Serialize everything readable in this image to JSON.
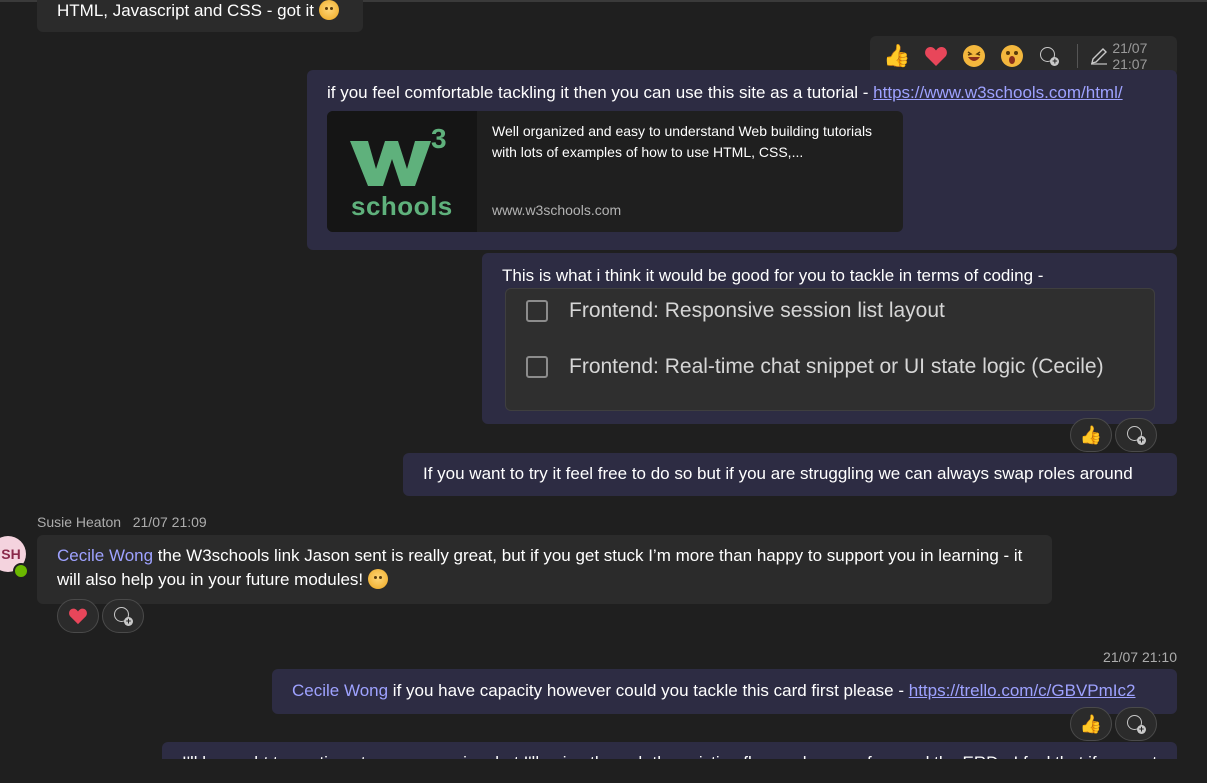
{
  "messages": {
    "m0": {
      "text": "HTML, Javascript and CSS - got it"
    },
    "m1": {
      "text": "if you feel comfortable tackling it then you can use this site as a tutorial - ",
      "link": "https://www.w3schools.com/html/",
      "preview": {
        "logo_text": "schools",
        "logo_sup": "3",
        "description": "Well organized and easy to understand Web building tutorials with lots of examples of how to use HTML, CSS,...",
        "domain": "www.w3schools.com"
      }
    },
    "m2": {
      "text": "This is what i think it would be good for you to tackle in terms of coding -",
      "tasks": [
        "Frontend: Responsive session list layout",
        "Frontend: Real-time chat snippet or UI state logic (Cecile)"
      ]
    },
    "m3": {
      "text": "If you want to try it feel free to do so but if you are struggling we can always swap roles around"
    },
    "m4": {
      "sender": "Susie Heaton",
      "time": "21/07 21:09",
      "avatar_initials": "SH",
      "mention": "Cecile Wong",
      "text": " the W3schools link Jason sent is really great, but if you get stuck I’m more than happy to support you in learning - it will also help you in your future modules!"
    },
    "m5": {
      "time": "21/07 21:10",
      "mention": "Cecile Wong",
      "text": " if you have capacity however could you tackle this card first please - ",
      "link": "https://trello.com/c/GBVPmIc2"
    },
    "m6": {
      "text": "I'll be ought to continue to answer no in a but I'll going through the existing flow and some of around the ERD - I feel that if you get"
    }
  },
  "reaction_bar": {
    "emojis": [
      "👍",
      "❤",
      "😆",
      "😮"
    ],
    "time": "21:07",
    "edited_prefix": "21/07"
  },
  "reactions": {
    "thumbs": "👍",
    "heart": "❤"
  },
  "colors": {
    "background": "#1f1f1f",
    "incoming_bubble": "#2b2b2b",
    "outgoing_bubble": "#2d2c43",
    "accent": "#9ea2ff",
    "presence": "#6bb700",
    "w3_green": "#5fb17c"
  }
}
